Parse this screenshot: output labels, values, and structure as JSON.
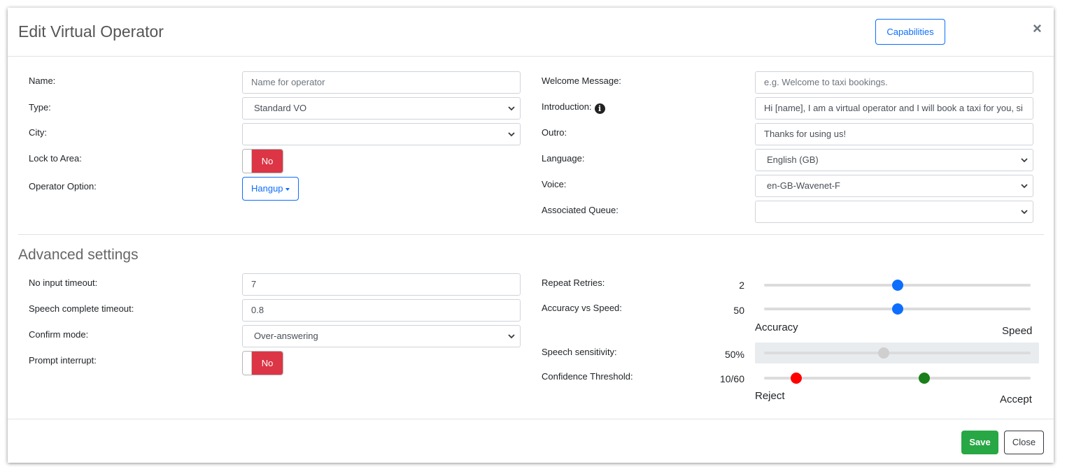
{
  "modal": {
    "title": "Edit Virtual Operator",
    "capabilities_label": "Capabilities",
    "close_symbol": "×"
  },
  "left": {
    "name_label": "Name:",
    "name_placeholder": "Name for operator",
    "type_label": "Type:",
    "type_value": "Standard VO",
    "city_label": "City:",
    "city_value": "",
    "lock_label": "Lock to Area:",
    "lock_value": "No",
    "option_label": "Operator Option:",
    "option_value": "Hangup"
  },
  "right": {
    "welcome_label": "Welcome Message:",
    "welcome_placeholder": "e.g. Welcome to taxi bookings.",
    "intro_label": "Introduction:",
    "intro_value": "Hi [name], I am a virtual operator and I will book a taxi for you, si",
    "outro_label": "Outro:",
    "outro_value": "Thanks for using us!",
    "language_label": "Language:",
    "language_value": "English (GB)",
    "voice_label": "Voice:",
    "voice_value": "en-GB-Wavenet-F",
    "queue_label": "Associated Queue:",
    "queue_value": ""
  },
  "advanced": {
    "title": "Advanced settings",
    "no_input_label": "No input timeout:",
    "no_input_value": "7",
    "speech_complete_label": "Speech complete timeout:",
    "speech_complete_value": "0.8",
    "confirm_label": "Confirm mode:",
    "confirm_value": "Over-answering",
    "prompt_label": "Prompt interrupt:",
    "prompt_value": "No",
    "repeat_label": "Repeat Retries:",
    "repeat_value": "2",
    "repeat_fraction": 0.5,
    "accuracy_label": "Accuracy vs Speed:",
    "accuracy_value": "50",
    "accuracy_fraction": 0.5,
    "accuracy_min": "Accuracy",
    "accuracy_max": "Speed",
    "sensitivity_label": "Speech sensitivity:",
    "sensitivity_value": "50%",
    "sensitivity_fraction": 0.45,
    "confidence_label": "Confidence Threshold:",
    "confidence_value": "10/60",
    "confidence_low_fraction": 0.12,
    "confidence_high_fraction": 0.6,
    "confidence_min": "Reject",
    "confidence_max": "Accept"
  },
  "footer": {
    "save_label": "Save",
    "close_label": "Close"
  },
  "colors": {
    "primary": "#0d6efd",
    "danger": "#dc3545",
    "success": "#28a745",
    "reject_thumb": "#ff0000",
    "accept_thumb": "#1a7f1a",
    "disabled_thumb": "#cfcfcf"
  }
}
